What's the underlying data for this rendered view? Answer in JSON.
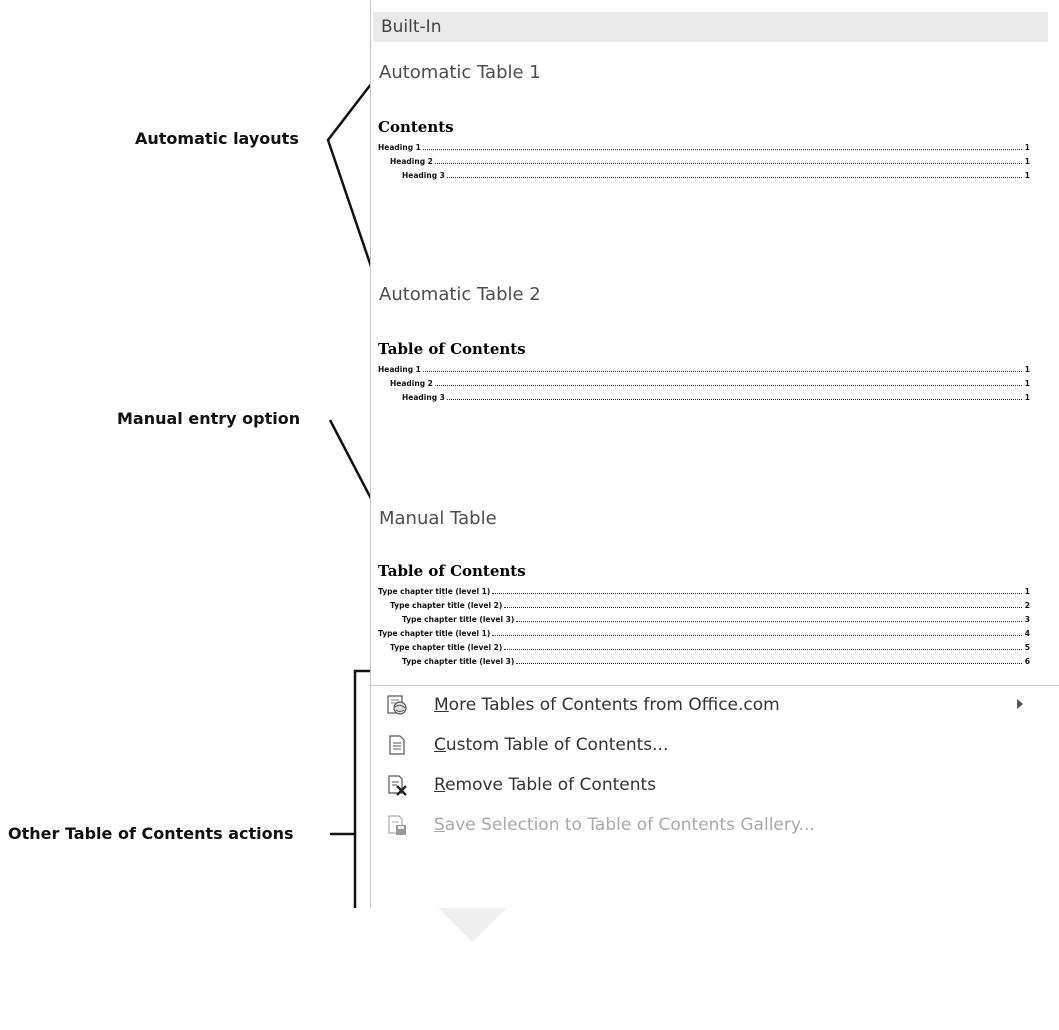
{
  "callouts": {
    "automatic": "Automatic layouts",
    "manual": "Manual entry option",
    "actions": "Other Table of Contents actions"
  },
  "gallery": {
    "section_header": "Built-In",
    "items": [
      {
        "title": "Automatic Table 1",
        "preview_title": "Contents",
        "rows": [
          {
            "label": "Heading 1",
            "page": "1",
            "level": 1
          },
          {
            "label": "Heading 2",
            "page": "1",
            "level": 2
          },
          {
            "label": "Heading 3",
            "page": "1",
            "level": 3
          }
        ]
      },
      {
        "title": "Automatic Table 2",
        "preview_title": "Table of Contents",
        "rows": [
          {
            "label": "Heading 1",
            "page": "1",
            "level": 1
          },
          {
            "label": "Heading 2",
            "page": "1",
            "level": 2
          },
          {
            "label": "Heading 3",
            "page": "1",
            "level": 3
          }
        ]
      },
      {
        "title": "Manual Table",
        "preview_title": "Table of Contents",
        "rows": [
          {
            "label": "Type chapter title (level 1)",
            "page": "1",
            "level": 1
          },
          {
            "label": "Type chapter title (level 2)",
            "page": "2",
            "level": 2
          },
          {
            "label": "Type chapter title (level 3)",
            "page": "3",
            "level": 3
          },
          {
            "label": "Type chapter title (level 1)",
            "page": "4",
            "level": 1
          },
          {
            "label": "Type chapter title (level 2)",
            "page": "5",
            "level": 2
          },
          {
            "label": "Type chapter title (level 3)",
            "page": "6",
            "level": 3
          }
        ]
      }
    ]
  },
  "menu": {
    "items": [
      {
        "key": "M",
        "rest": "ore Tables of Contents from Office.com",
        "icon": "globe-doc-icon",
        "submenu": true,
        "enabled": true
      },
      {
        "key": "C",
        "rest": "ustom Table of Contents...",
        "icon": "document-icon",
        "submenu": false,
        "enabled": true
      },
      {
        "key": "R",
        "rest": "emove Table of Contents",
        "icon": "remove-doc-icon",
        "submenu": false,
        "enabled": true
      },
      {
        "key": "S",
        "rest": "ave Selection to Table of Contents Gallery...",
        "icon": "save-doc-icon",
        "submenu": false,
        "enabled": false
      }
    ]
  },
  "colors": {
    "header_bg": "#e9e9e9",
    "label_text": "#333333",
    "disabled_text": "#a8a8a8",
    "watermark": "#f0f0f0"
  }
}
